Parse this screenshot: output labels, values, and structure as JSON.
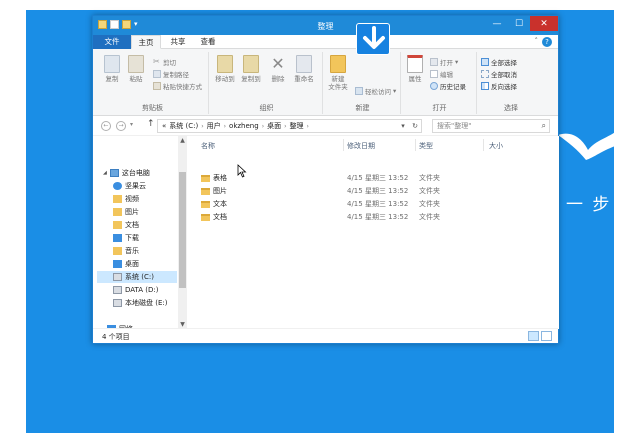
{
  "window": {
    "title": "整理",
    "controls": {
      "minimize": "—",
      "maximize": "☐",
      "close": "✕"
    }
  },
  "tabs": {
    "file": "文件",
    "home": "主页",
    "share": "共享",
    "view": "查看",
    "help": "?"
  },
  "ribbon": {
    "clipboard": {
      "label": "剪贴板",
      "copy": "复制",
      "paste": "粘贴",
      "cut": "剪切",
      "copy_path": "复制路径",
      "paste_shortcut": "粘贴快捷方式"
    },
    "organize": {
      "label": "组织",
      "move_to": "移动到",
      "copy_to": "复制到",
      "delete": "删除",
      "rename": "重命名"
    },
    "new": {
      "label": "新建",
      "new_folder": "新建\n文件夹",
      "easy_access": "轻松访问"
    },
    "open": {
      "label": "打开",
      "properties": "属性",
      "open": "打开",
      "edit": "编辑",
      "history": "历史记录"
    },
    "select": {
      "label": "选择",
      "select_all": "全部选择",
      "select_none": "全部取消",
      "invert": "反向选择"
    }
  },
  "address": {
    "segments": [
      "«",
      "系统 (C:)",
      "用户",
      "okzheng",
      "桌面",
      "整理"
    ],
    "search_placeholder": "搜索\"整理\""
  },
  "nav": {
    "items": [
      {
        "label": "这台电脑",
        "icon": "computer-icon",
        "level": 0
      },
      {
        "label": "坚果云",
        "icon": "cloud-icon",
        "level": 1
      },
      {
        "label": "视频",
        "icon": "video-icon",
        "level": 1
      },
      {
        "label": "图片",
        "icon": "pictures-icon",
        "level": 1
      },
      {
        "label": "文档",
        "icon": "documents-icon",
        "level": 1
      },
      {
        "label": "下载",
        "icon": "downloads-icon",
        "level": 1
      },
      {
        "label": "音乐",
        "icon": "music-icon",
        "level": 1
      },
      {
        "label": "桌面",
        "icon": "desktop-icon",
        "level": 1
      },
      {
        "label": "系统 (C:)",
        "icon": "drive-icon",
        "level": 1,
        "selected": true
      },
      {
        "label": "DATA (D:)",
        "icon": "drive-icon",
        "level": 1
      },
      {
        "label": "本地磁盘 (E:)",
        "icon": "drive-icon",
        "level": 1
      },
      {
        "label": "网络",
        "icon": "network-icon",
        "level": 0
      }
    ]
  },
  "files": {
    "columns": {
      "name": "名称",
      "date": "修改日期",
      "type": "类型",
      "size": "大小"
    },
    "rows": [
      {
        "name": "表格",
        "date": "4/15 星期三 13:52",
        "type": "文件夹"
      },
      {
        "name": "图片",
        "date": "4/15 星期三 13:52",
        "type": "文件夹"
      },
      {
        "name": "文本",
        "date": "4/15 星期三 13:52",
        "type": "文件夹"
      },
      {
        "name": "文档",
        "date": "4/15 星期三 13:52",
        "type": "文件夹"
      }
    ]
  },
  "status": {
    "count": "4 个项目"
  },
  "desktop": {
    "overlay_text": "一 步"
  },
  "colors": {
    "desktop": "#1a8ee6",
    "titlebar": "#1f8ad8",
    "file_tab": "#1f6fc0",
    "close_button": "#c9312c",
    "folder": "#f2c55b",
    "selection": "#cce8ff"
  }
}
